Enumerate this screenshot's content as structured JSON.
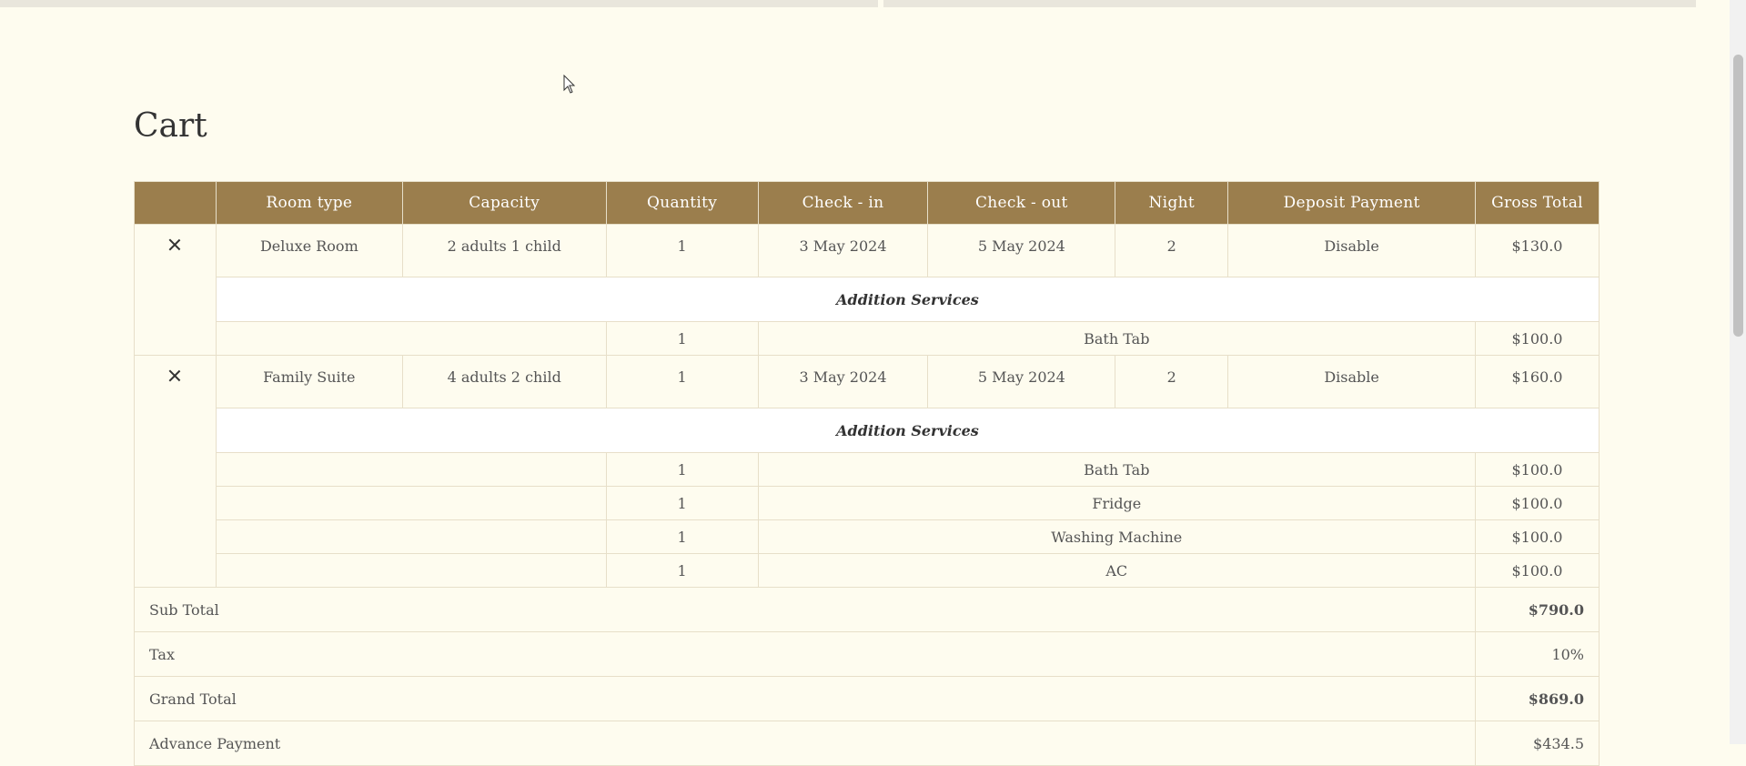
{
  "page": {
    "title": "Cart"
  },
  "table": {
    "headers": [
      "",
      "Room type",
      "Capacity",
      "Quantity",
      "Check - in",
      "Check - out",
      "Night",
      "Deposit Payment",
      "Gross Total"
    ],
    "rooms": [
      {
        "room_type": "Deluxe Room",
        "capacity": "2 adults 1 child",
        "quantity": "1",
        "check_in": "3 May 2024",
        "check_out": "5 May 2024",
        "night": "2",
        "deposit": "Disable",
        "gross": "$130.0",
        "services_title": "Addition Services",
        "services": [
          {
            "qty": "1",
            "name": "Bath Tab",
            "price": "$100.0"
          }
        ]
      },
      {
        "room_type": "Family Suite",
        "capacity": "4 adults 2 child",
        "quantity": "1",
        "check_in": "3 May 2024",
        "check_out": "5 May 2024",
        "night": "2",
        "deposit": "Disable",
        "gross": "$160.0",
        "services_title": "Addition Services",
        "services": [
          {
            "qty": "1",
            "name": "Bath Tab",
            "price": "$100.0"
          },
          {
            "qty": "1",
            "name": "Fridge",
            "price": "$100.0"
          },
          {
            "qty": "1",
            "name": "Washing Machine",
            "price": "$100.0"
          },
          {
            "qty": "1",
            "name": "AC",
            "price": "$100.0"
          }
        ]
      }
    ],
    "summary": {
      "sub_total_label": "Sub Total",
      "sub_total": "$790.0",
      "tax_label": "Tax",
      "tax": "10%",
      "grand_total_label": "Grand Total",
      "grand_total": "$869.0",
      "advance_label": "Advance Payment",
      "advance": "$434.5"
    }
  },
  "icons": {
    "remove": "close-icon",
    "cursor": "mouse-pointer-icon"
  },
  "colors": {
    "header_bg": "#9b7e4d",
    "page_bg": "#fefcef",
    "border": "#e7dfc9"
  }
}
